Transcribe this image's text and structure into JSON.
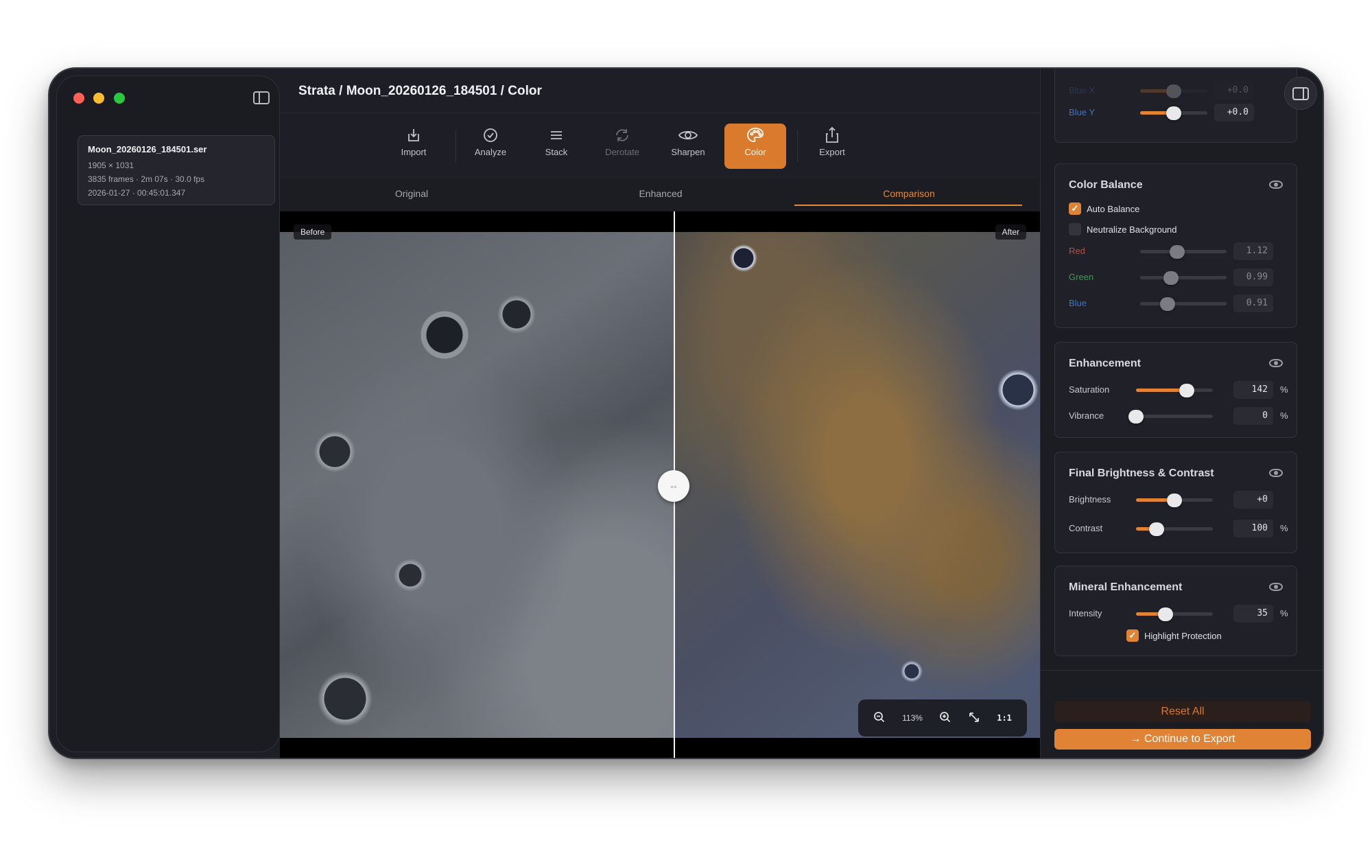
{
  "sidebar": {
    "file": {
      "name": "Moon_20260126_184501.ser",
      "resolution": "1905 × 1031",
      "frames": "3835 frames · 2m 07s · 30.0 fps",
      "timestamp": "2026-01-27 · 00:45:01.347"
    }
  },
  "header": {
    "breadcrumb": "Strata / Moon_20260126_184501 / Color"
  },
  "toolbar": {
    "items": [
      {
        "label": "Import",
        "icon": "import-icon"
      },
      {
        "label": "Analyze",
        "icon": "checkmark-circle-icon"
      },
      {
        "label": "Stack",
        "icon": "stack-lines-icon"
      },
      {
        "label": "Derotate",
        "icon": "rotate-arrows-icon",
        "disabled": true
      },
      {
        "label": "Sharpen",
        "icon": "eye-icon"
      },
      {
        "label": "Color",
        "icon": "palette-icon",
        "active": true
      },
      {
        "label": "Export",
        "icon": "share-icon"
      }
    ]
  },
  "view_tabs": {
    "items": [
      "Original",
      "Enhanced",
      "Comparison"
    ],
    "active": "Comparison"
  },
  "viewer": {
    "before_label": "Before",
    "after_label": "After",
    "split_position": 0.52,
    "zoom_level": "113%",
    "actual_size_label": "1:1"
  },
  "panel": {
    "top_partial": {
      "row_label": "Blue Y",
      "row_value": "+0.0",
      "faded_label": "Blue X",
      "faded_value": "+0.0",
      "slider_fraction": 0.5
    },
    "color_balance": {
      "title": "Color Balance",
      "auto_balance": {
        "label": "Auto Balance",
        "checked": true
      },
      "neutralize": {
        "label": "Neutralize Background",
        "checked": false
      },
      "channels": [
        {
          "name": "Red",
          "value": "1.12",
          "color": "#c14a3f",
          "fraction": 0.43
        },
        {
          "name": "Green",
          "value": "0.99",
          "color": "#3d9a4d",
          "fraction": 0.36
        },
        {
          "name": "Blue",
          "value": "0.91",
          "color": "#3a73c9",
          "fraction": 0.32
        }
      ]
    },
    "enhancement": {
      "title": "Enhancement",
      "saturation": {
        "label": "Saturation",
        "value": "142",
        "unit": "%",
        "fraction": 0.66
      },
      "vibrance": {
        "label": "Vibrance",
        "value": "0",
        "unit": "%",
        "fraction": 0.0
      }
    },
    "final": {
      "title": "Final Brightness & Contrast",
      "brightness": {
        "label": "Brightness",
        "value": "+0",
        "fraction": 0.5
      },
      "contrast": {
        "label": "Contrast",
        "value": "100",
        "unit": "%",
        "fraction": 0.27
      }
    },
    "mineral": {
      "title": "Mineral Enhancement",
      "intensity": {
        "label": "Intensity",
        "value": "35",
        "unit": "%",
        "fraction": 0.38
      },
      "highlight_protection": {
        "label": "Highlight Protection",
        "checked": true
      }
    },
    "reset_label": "Reset All",
    "continue_label": "Continue to Export",
    "continue_icon": "arrow-right-icon"
  },
  "colors": {
    "accent": "#e08334",
    "window_bg": "#1e1f26"
  }
}
